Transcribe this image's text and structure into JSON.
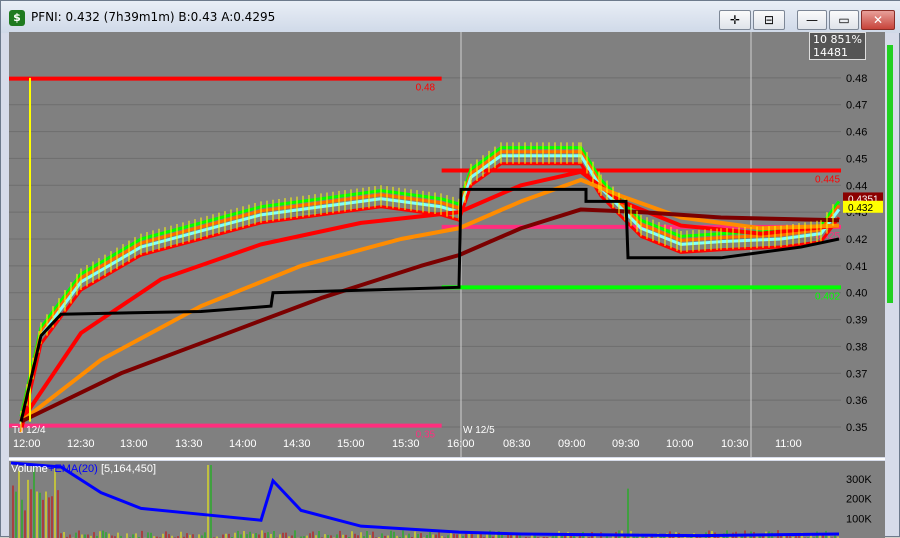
{
  "window": {
    "title": "PFNI: 0.432 (7h39m1m) B:0.43 A:0.4295",
    "icon": "dollar-icon",
    "buttons": {
      "crosshair": "✛",
      "pin": "⊟",
      "minimize": "—",
      "maximize": "▭",
      "close": "✕"
    }
  },
  "overlay": {
    "percent": "851%",
    "value_partial": "10",
    "count": "14481"
  },
  "price_axis": {
    "ticks": [
      "0.48",
      "0.47",
      "0.46",
      "0.45",
      "0.44",
      "0.43",
      "0.42",
      "0.41",
      "0.40",
      "0.39",
      "0.38",
      "0.37",
      "0.36",
      "0.35"
    ],
    "tick_values": [
      0.48,
      0.47,
      0.46,
      0.45,
      0.44,
      0.43,
      0.42,
      0.41,
      0.4,
      0.39,
      0.38,
      0.37,
      0.36,
      0.35
    ],
    "min": 0.35,
    "max": 0.49,
    "tags": [
      {
        "text": "0.4351",
        "value": 0.4351,
        "bg": "#8b0000",
        "fg": "#ffffff"
      },
      {
        "text": "0.432",
        "value": 0.432,
        "bg": "#ffff00",
        "fg": "#000000"
      }
    ]
  },
  "time_axis": {
    "labels": [
      "12:00",
      "12:30",
      "13:00",
      "13:30",
      "14:00",
      "14:30",
      "15:00",
      "15:30",
      "16:00",
      "08:30",
      "09:00",
      "09:30",
      "10:00",
      "10:30",
      "11:00"
    ],
    "day_labels": [
      "Tu 12/4",
      "W  12/5"
    ]
  },
  "levels": [
    {
      "label": "0.48",
      "value": 0.4797,
      "color": "#ff0000",
      "from": 0.0,
      "to": 0.52
    },
    {
      "label": "0.445",
      "value": 0.4455,
      "color": "#ff0000",
      "from": 0.52,
      "to": 1.0
    },
    {
      "label": "0.425",
      "value": 0.4245,
      "color": "#ff2e7e",
      "from": 0.52,
      "to": 1.0
    },
    {
      "label": "0.402",
      "value": 0.402,
      "color": "#00ff00",
      "from": 0.52,
      "to": 1.0
    },
    {
      "label": "0.35",
      "value": 0.3505,
      "color": "#ff2e7e",
      "from": 0.0,
      "to": 0.52
    }
  ],
  "volume_panel": {
    "legend_label": "Volume",
    "ema_label": "+EMA(20)",
    "ema_value": "[5,164,450]",
    "ticks": [
      "300K",
      "200K",
      "100K"
    ],
    "tick_values": [
      300000,
      200000,
      100000
    ],
    "max": 380000
  },
  "colors": {
    "chart_bg": "#808080",
    "grid": "#6e6e6e",
    "session_divider": "#d0d0d0",
    "price_text": "#000000",
    "volume_line": "#0000ff"
  }
}
